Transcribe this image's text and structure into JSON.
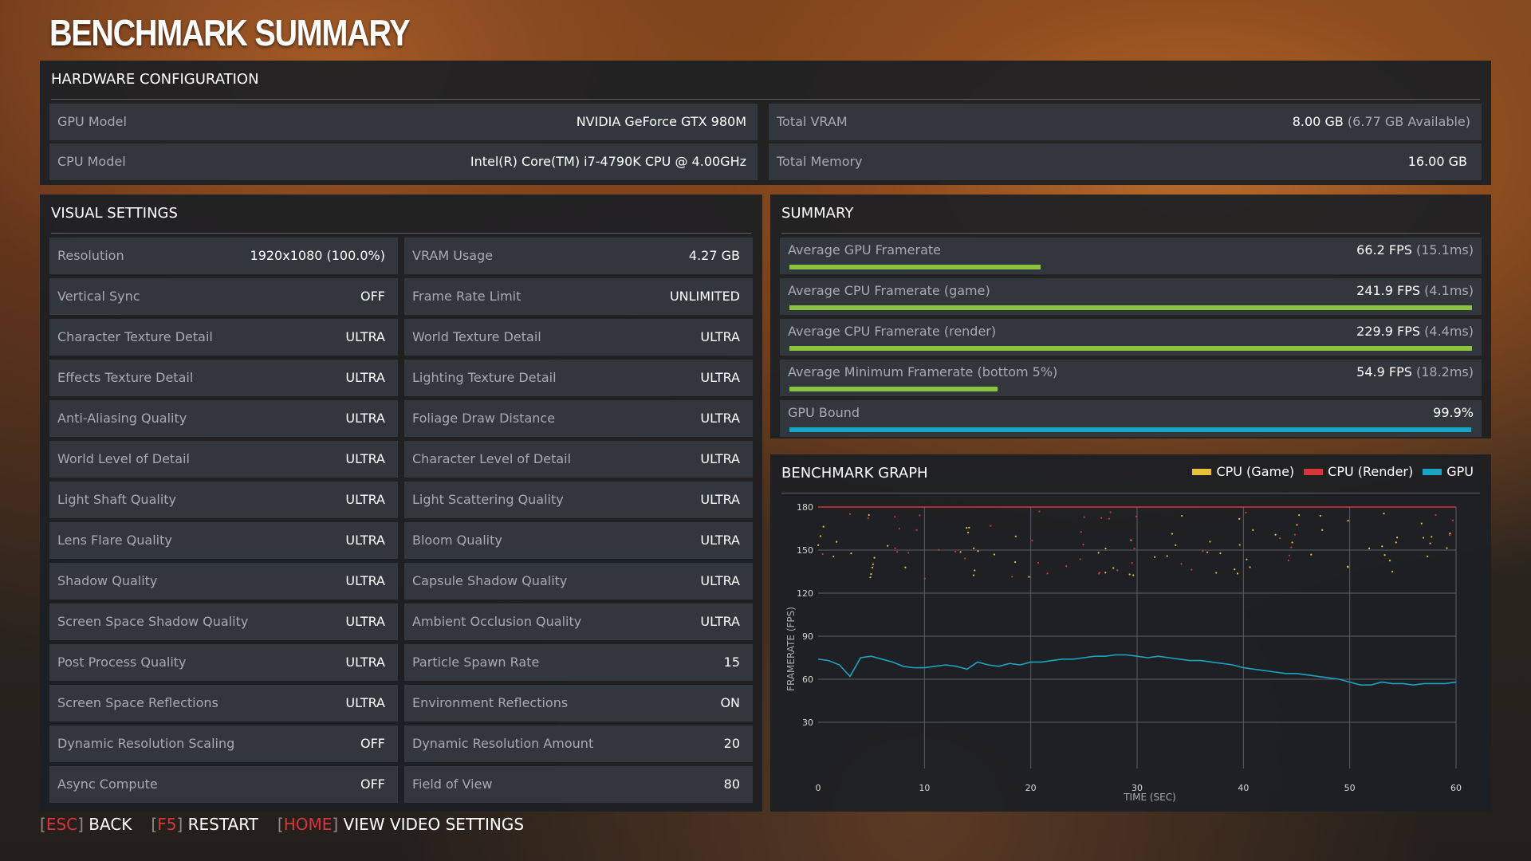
{
  "title": "BENCHMARK SUMMARY",
  "hardware": {
    "header": "HARDWARE CONFIGURATION",
    "rows": [
      {
        "label": "GPU Model",
        "value": "NVIDIA GeForce GTX 980M",
        "sub": ""
      },
      {
        "label": "Total VRAM",
        "value": "8.00 GB",
        "sub": "(6.77 GB Available)"
      },
      {
        "label": "CPU Model",
        "value": "Intel(R) Core(TM) i7-4790K CPU @ 4.00GHz",
        "sub": ""
      },
      {
        "label": "Total Memory",
        "value": "16.00 GB",
        "sub": ""
      }
    ]
  },
  "visual_settings": {
    "header": "VISUAL SETTINGS",
    "left": [
      {
        "label": "Resolution",
        "value": "1920x1080 (100.0%)"
      },
      {
        "label": "Vertical Sync",
        "value": "OFF"
      },
      {
        "label": "Character Texture Detail",
        "value": "ULTRA"
      },
      {
        "label": "Effects Texture Detail",
        "value": "ULTRA"
      },
      {
        "label": "Anti-Aliasing Quality",
        "value": "ULTRA"
      },
      {
        "label": "World Level of Detail",
        "value": "ULTRA"
      },
      {
        "label": "Light Shaft Quality",
        "value": "ULTRA"
      },
      {
        "label": "Lens Flare Quality",
        "value": "ULTRA"
      },
      {
        "label": "Shadow Quality",
        "value": "ULTRA"
      },
      {
        "label": "Screen Space Shadow Quality",
        "value": "ULTRA"
      },
      {
        "label": "Post Process Quality",
        "value": "ULTRA"
      },
      {
        "label": "Screen Space Reflections",
        "value": "ULTRA"
      },
      {
        "label": "Dynamic Resolution Scaling",
        "value": "OFF"
      },
      {
        "label": "Async Compute",
        "value": "OFF"
      }
    ],
    "right": [
      {
        "label": "VRAM Usage",
        "value": "4.27 GB"
      },
      {
        "label": "Frame Rate Limit",
        "value": "UNLIMITED"
      },
      {
        "label": "World Texture Detail",
        "value": "ULTRA"
      },
      {
        "label": "Lighting Texture Detail",
        "value": "ULTRA"
      },
      {
        "label": "Foliage Draw Distance",
        "value": "ULTRA"
      },
      {
        "label": "Character Level of Detail",
        "value": "ULTRA"
      },
      {
        "label": "Light Scattering Quality",
        "value": "ULTRA"
      },
      {
        "label": "Bloom Quality",
        "value": "ULTRA"
      },
      {
        "label": "Capsule Shadow Quality",
        "value": "ULTRA"
      },
      {
        "label": "Ambient Occlusion Quality",
        "value": "ULTRA"
      },
      {
        "label": "Particle Spawn Rate",
        "value": "15"
      },
      {
        "label": "Environment Reflections",
        "value": "ON"
      },
      {
        "label": "Dynamic Resolution Amount",
        "value": "20"
      },
      {
        "label": "Field of View",
        "value": "80"
      }
    ]
  },
  "summary": {
    "header": "SUMMARY",
    "rows": [
      {
        "label": "Average GPU Framerate",
        "value": "66.2 FPS",
        "sub": "(15.1ms)",
        "fraction": 0.368,
        "color": "#8bc53f"
      },
      {
        "label": "Average CPU Framerate (game)",
        "value": "241.9 FPS",
        "sub": "(4.1ms)",
        "fraction": 1.0,
        "color": "#8bc53f"
      },
      {
        "label": "Average CPU Framerate (render)",
        "value": "229.9 FPS",
        "sub": "(4.4ms)",
        "fraction": 1.0,
        "color": "#8bc53f"
      },
      {
        "label": "Average Minimum Framerate (bottom 5%)",
        "value": "54.9 FPS",
        "sub": "(18.2ms)",
        "fraction": 0.305,
        "color": "#8bc53f"
      },
      {
        "label": "GPU Bound",
        "value": "99.9%",
        "sub": "",
        "fraction": 0.999,
        "color": "#1aa3c4"
      }
    ]
  },
  "graph": {
    "header": "BENCHMARK GRAPH",
    "legend": [
      {
        "name": "CPU (Game)",
        "color": "#e8c13a"
      },
      {
        "name": "CPU (Render)",
        "color": "#d8353a"
      },
      {
        "name": "GPU",
        "color": "#1aa3c4"
      }
    ]
  },
  "chart_data": {
    "type": "line",
    "title": "BENCHMARK GRAPH",
    "xlabel": "TIME (SEC)",
    "ylabel": "FRAMERATE (FPS)",
    "xlim": [
      0,
      60
    ],
    "ylim": [
      0,
      180
    ],
    "xticks": [
      0,
      10,
      20,
      30,
      40,
      50,
      60
    ],
    "yticks": [
      30,
      60,
      90,
      120,
      150,
      180
    ],
    "grid": true,
    "legend_position": "top-right",
    "series": [
      {
        "name": "GPU",
        "color": "#1aa3c4",
        "x": [
          0,
          1,
          2,
          3,
          4,
          5,
          6,
          7,
          8,
          9,
          10,
          11,
          12,
          13,
          14,
          15,
          16,
          17,
          18,
          19,
          20,
          21,
          22,
          23,
          24,
          25,
          26,
          27,
          28,
          29,
          30,
          31,
          32,
          33,
          34,
          35,
          36,
          37,
          38,
          39,
          40,
          41,
          42,
          43,
          44,
          45,
          46,
          47,
          48,
          49,
          50,
          51,
          52,
          53,
          54,
          55,
          56,
          57,
          58,
          59,
          60
        ],
        "y": [
          74,
          73,
          70,
          62,
          75,
          76,
          74,
          72,
          69,
          68,
          68,
          69,
          70,
          69,
          67,
          72,
          70,
          69,
          71,
          70,
          72,
          72,
          73,
          74,
          74,
          75,
          76,
          76,
          77,
          77,
          76,
          75,
          76,
          75,
          74,
          73,
          73,
          72,
          71,
          70,
          68,
          67,
          66,
          65,
          64,
          64,
          63,
          62,
          61,
          60,
          58,
          56,
          56,
          58,
          57,
          57,
          56,
          57,
          57,
          57,
          58
        ]
      },
      {
        "name": "CPU (Render)",
        "color": "#d8353a",
        "x": [
          0,
          60
        ],
        "y": [
          180,
          180
        ]
      }
    ]
  },
  "footer": [
    {
      "key": "ESC",
      "action": "BACK"
    },
    {
      "key": "F5",
      "action": "RESTART"
    },
    {
      "key": "HOME",
      "action": "VIEW VIDEO SETTINGS"
    }
  ]
}
